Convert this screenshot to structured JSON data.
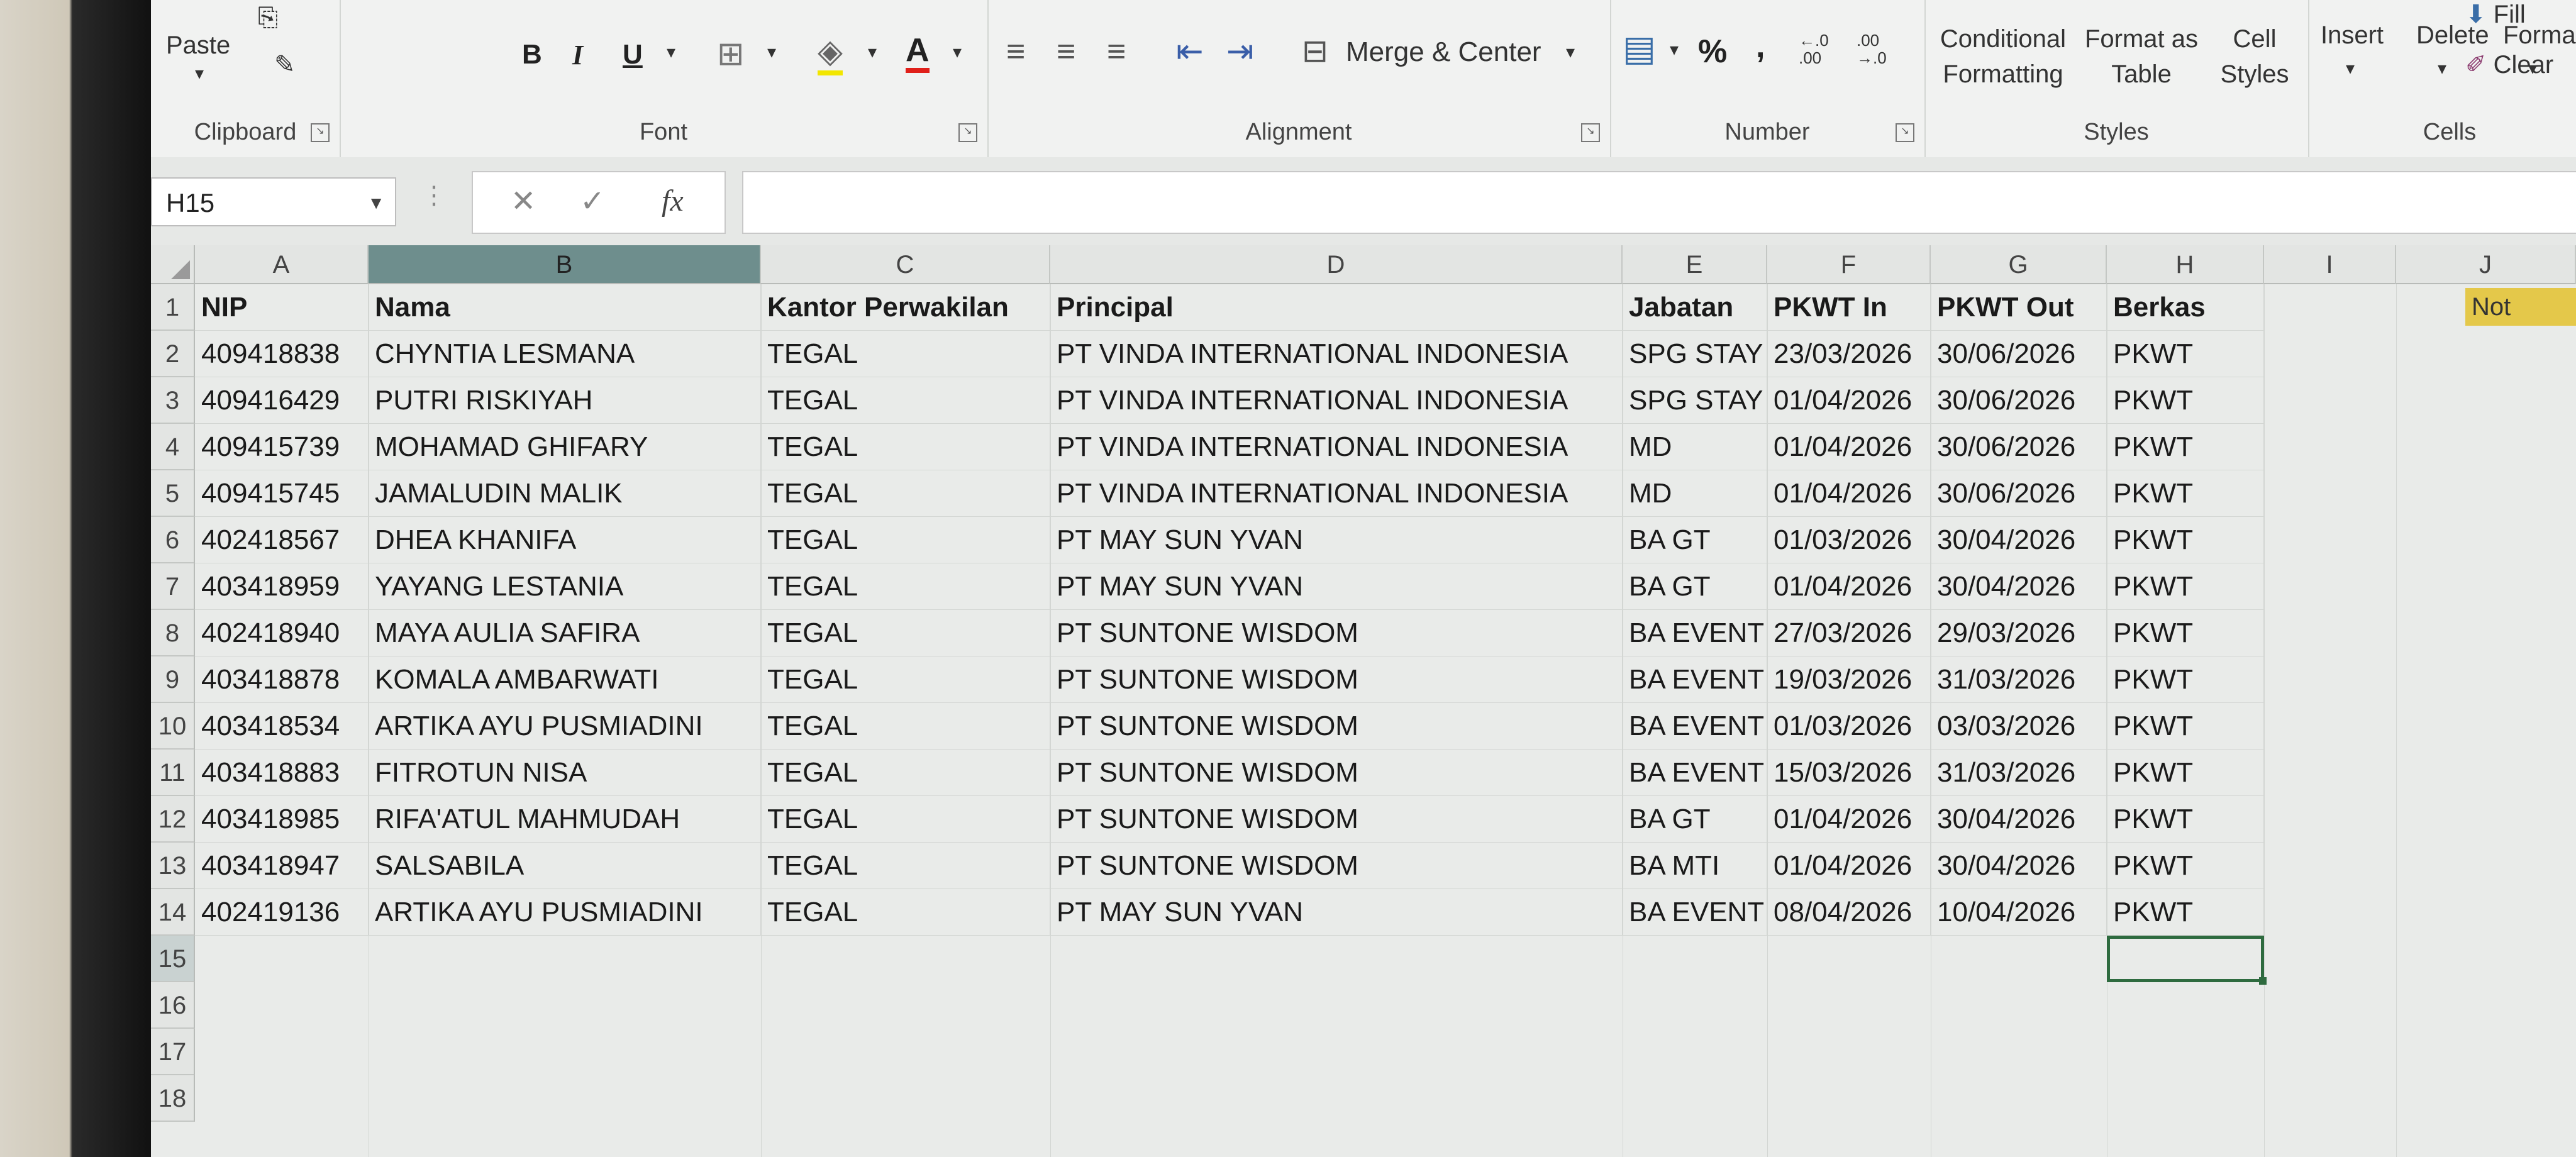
{
  "ribbon": {
    "clipboard": {
      "paste_label": "Paste",
      "group_label": "Clipboard"
    },
    "font": {
      "bold": "B",
      "italic": "I",
      "underline": "U",
      "font_color_letter": "A",
      "group_label": "Font"
    },
    "alignment": {
      "merge_center_label": "Merge & Center",
      "group_label": "Alignment"
    },
    "number": {
      "percent": "%",
      "comma": ",",
      "inc_decimal": "←.0 .00",
      "dec_decimal": ".00 →.0",
      "group_label": "Number"
    },
    "styles": {
      "conditional_formatting": [
        "Conditional",
        "Formatting"
      ],
      "format_as_table": [
        "Format as",
        "Table"
      ],
      "cell_styles": [
        "Cell",
        "Styles"
      ],
      "group_label": "Styles"
    },
    "cells": {
      "insert_label": "Insert",
      "delete_label": "Delete",
      "format_label": "Format",
      "group_label": "Cells"
    },
    "editing": {
      "fill_label": "Fill",
      "clear_label": "Clear"
    }
  },
  "formula_bar": {
    "name_box": "H15",
    "fx": "fx",
    "value": ""
  },
  "sheet": {
    "columns": [
      "A",
      "B",
      "C",
      "D",
      "E",
      "F",
      "G",
      "H",
      "I",
      "J"
    ],
    "selected_column": "B",
    "active_cell": "H15",
    "headers": [
      "NIP",
      "Nama",
      "Kantor Perwakilan",
      "Principal",
      "Jabatan",
      "PKWT In",
      "PKWT Out",
      "Berkas"
    ],
    "overflow_note": "Not",
    "rows": [
      [
        "409418838",
        "CHYNTIA LESMANA",
        "TEGAL",
        "PT VINDA INTERNATIONAL INDONESIA",
        "SPG STAY",
        "23/03/2026",
        "30/06/2026",
        "PKWT"
      ],
      [
        "409416429",
        "PUTRI RISKIYAH",
        "TEGAL",
        "PT VINDA INTERNATIONAL INDONESIA",
        "SPG STAY",
        "01/04/2026",
        "30/06/2026",
        "PKWT"
      ],
      [
        "409415739",
        "MOHAMAD GHIFARY",
        "TEGAL",
        "PT VINDA INTERNATIONAL INDONESIA",
        "MD",
        "01/04/2026",
        "30/06/2026",
        "PKWT"
      ],
      [
        "409415745",
        "JAMALUDIN MALIK",
        "TEGAL",
        "PT VINDA INTERNATIONAL INDONESIA",
        "MD",
        "01/04/2026",
        "30/06/2026",
        "PKWT"
      ],
      [
        "402418567",
        "DHEA KHANIFA",
        "TEGAL",
        "PT MAY SUN YVAN",
        "BA GT",
        "01/03/2026",
        "30/04/2026",
        "PKWT"
      ],
      [
        "403418959",
        "YAYANG LESTANIA",
        "TEGAL",
        "PT MAY SUN YVAN",
        "BA GT",
        "01/04/2026",
        "30/04/2026",
        "PKWT"
      ],
      [
        "402418940",
        "MAYA AULIA SAFIRA",
        "TEGAL",
        "PT SUNTONE WISDOM",
        "BA EVENT",
        "27/03/2026",
        "29/03/2026",
        "PKWT"
      ],
      [
        "403418878",
        "KOMALA AMBARWATI",
        "TEGAL",
        "PT SUNTONE WISDOM",
        "BA EVENT",
        "19/03/2026",
        "31/03/2026",
        "PKWT"
      ],
      [
        "403418534",
        "ARTIKA AYU PUSMIADINI",
        "TEGAL",
        "PT SUNTONE WISDOM",
        "BA EVENT",
        "01/03/2026",
        "03/03/2026",
        "PKWT"
      ],
      [
        "403418883",
        "FITROTUN NISA",
        "TEGAL",
        "PT SUNTONE WISDOM",
        "BA EVENT",
        "15/03/2026",
        "31/03/2026",
        "PKWT"
      ],
      [
        "403418985",
        "RIFA'ATUL MAHMUDAH",
        "TEGAL",
        "PT SUNTONE WISDOM",
        "BA GT",
        "01/04/2026",
        "30/04/2026",
        "PKWT"
      ],
      [
        "403418947",
        "SALSABILA",
        "TEGAL",
        "PT SUNTONE WISDOM",
        "BA MTI",
        "01/04/2026",
        "30/04/2026",
        "PKWT"
      ],
      [
        "402419136",
        "ARTIKA AYU PUSMIADINI",
        "TEGAL",
        "PT MAY SUN YVAN",
        "BA EVENT",
        "08/04/2026",
        "10/04/2026",
        "PKWT"
      ]
    ],
    "row_numbers": [
      "1",
      "2",
      "3",
      "4",
      "5",
      "6",
      "7",
      "8",
      "9",
      "10",
      "11",
      "12",
      "13",
      "14",
      "15",
      "16",
      "17",
      "18"
    ]
  }
}
